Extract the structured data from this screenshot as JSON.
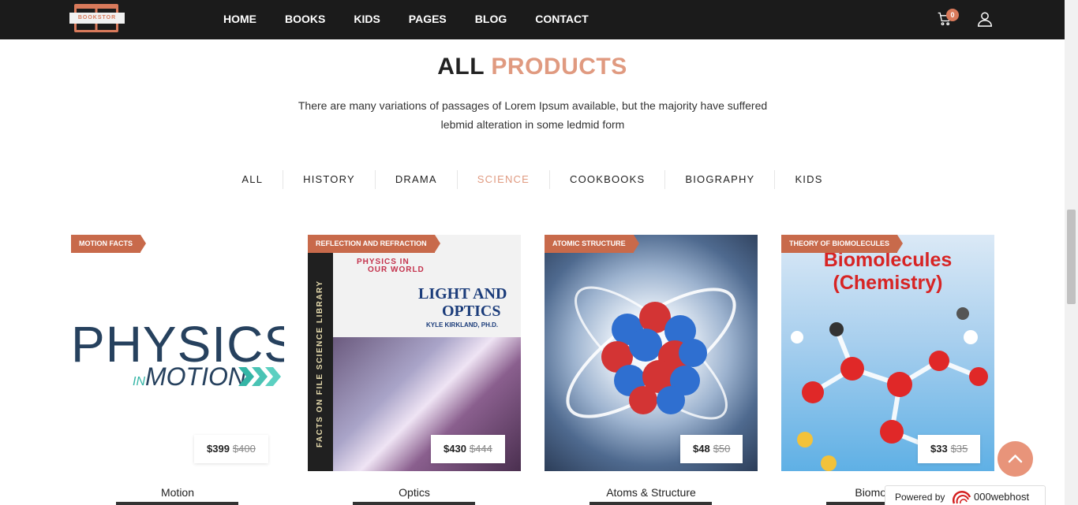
{
  "header": {
    "logo_text": "BOOKSTOR",
    "nav": [
      "HOME",
      "BOOKS",
      "KIDS",
      "PAGES",
      "BLOG",
      "CONTACT"
    ],
    "cart_count": "0"
  },
  "section": {
    "title_a": "ALL",
    "title_b": "PRODUCTS",
    "subtitle": "There are many variations of passages of Lorem Ipsum available, but the majority have suffered lebmid alteration in some ledmid form"
  },
  "filters": {
    "items": [
      "ALL",
      "HISTORY",
      "DRAMA",
      "SCIENCE",
      "COOKBOOKS",
      "BIOGRAPHY",
      "KIDS"
    ],
    "active": "SCIENCE"
  },
  "products": [
    {
      "badge": "MOTION FACTS",
      "price": "$399",
      "old_price": "$400",
      "name": "Motion",
      "cover_big": "PHYSICS",
      "cover_in": "IN",
      "cover_small": "MOTION"
    },
    {
      "badge": "REFLECTION AND REFRACTION",
      "price": "$430",
      "old_price": "$444",
      "name": "Optics",
      "cover_series_1": "PHYSICS IN",
      "cover_series_2": "OUR WORLD",
      "cover_title_1": "LIGHT AND",
      "cover_title_2": "OPTICS",
      "cover_author": "KYLE KIRKLAND, PH.D.",
      "cover_spine": "FACTS ON FILE SCIENCE LIBRARY"
    },
    {
      "badge": "ATOMIC STRUCTURE",
      "price": "$48",
      "old_price": "$50",
      "name": "Atoms & Structure"
    },
    {
      "badge": "THEORY OF BIOMOLECULES",
      "price": "$33",
      "old_price": "$35",
      "name": "Biomolecules",
      "cover_title_1": "Biomolecules",
      "cover_title_2": "(Chemistry)"
    }
  ],
  "footer_widget": {
    "powered_by": "Powered by",
    "brand": "000webhost"
  },
  "colors": {
    "accent": "#e09a80",
    "badge": "#c86a4b",
    "header_bg": "#1b1b1b"
  }
}
